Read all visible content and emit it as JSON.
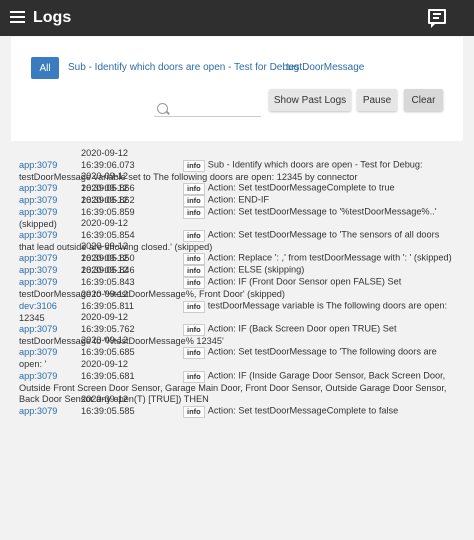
{
  "appbar": {
    "title": "Logs",
    "menu_icon": "menu-icon",
    "chat_icon": "chat-icon"
  },
  "filters": {
    "all_label": "All",
    "items": [
      "Sub - Identify which doors are open - Test for Debug",
      "testDoorMessage"
    ]
  },
  "search": {
    "placeholder": ""
  },
  "controls": {
    "show_past_logs": "Show Past Logs",
    "pause": "Pause",
    "clear": "Clear"
  },
  "logs": [
    {
      "src": "app:3079",
      "ts": "2020-09-12 16:39:06.073",
      "level": "info",
      "msg": "Sub - Identify which doors are open - Test for Debug: testDoorMessage variable set to The following doors are open:  12345 by connector"
    },
    {
      "src": "app:3079",
      "ts": "2020-09-12 16:39:05.866",
      "level": "info",
      "msg": "Action: Set testDoorMessageComplete to true"
    },
    {
      "src": "app:3079",
      "ts": "2020-09-12 16:39:05.862",
      "level": "info",
      "msg": "Action: END-IF"
    },
    {
      "src": "app:3079",
      "ts": "2020-09-12 16:39:05.859",
      "level": "info",
      "msg": "Action:     Set testDoorMessage to '%testDoorMessage%..' (skipped)"
    },
    {
      "src": "app:3079",
      "ts": "2020-09-12 16:39:05.854",
      "level": "info",
      "msg": "Action:     Set testDoorMessage to 'The sensors of all doors that lead outside are showing closed.' (skipped)"
    },
    {
      "src": "app:3079",
      "ts": "2020-09-12 16:39:05.850",
      "level": "info",
      "msg": "Action:     Replace ': ,' from testDoorMessage with ': ' (skipped)"
    },
    {
      "src": "app:3079",
      "ts": "2020-09-12 16:39:05.846",
      "level": "info",
      "msg": "Action: ELSE (skipping)"
    },
    {
      "src": "app:3079",
      "ts": "2020-09-12 16:39:05.843",
      "level": "info",
      "msg": "Action:     IF (Front Door Sensor open FALSE) Set testDoorMessage to '%testDoorMessage%, Front Door' (skipped)"
    },
    {
      "src": "dev:3106",
      "ts": "2020-09-12 16:39:05.811",
      "level": "info",
      "msg": "testDoorMessage variable is The following doors are open: 12345"
    },
    {
      "src": "app:3079",
      "ts": "2020-09-12 16:39:05.762",
      "level": "info",
      "msg": "Action:     IF (Back Screen Door open TRUE) Set testDoorMessage to '%testDoorMessage% 12345'"
    },
    {
      "src": "app:3079",
      "ts": "2020-09-12 16:39:05.685",
      "level": "info",
      "msg": "Action:     Set testDoorMessage to 'The following doors are open: '"
    },
    {
      "src": "app:3079",
      "ts": "2020-09-12 16:39:05.681",
      "level": "info",
      "msg": "Action: IF (Inside Garage Door Sensor, Back Screen Door, Outside Front Screen Door Sensor, Garage Main Door, Front Door Sensor, Outside Garage Door Sensor, Back Door Sensor any open(T) [TRUE]) THEN"
    },
    {
      "src": "app:3079",
      "ts": "2020-09-12 16:39:05.585",
      "level": "info",
      "msg": "Action: Set testDoorMessageComplete to false"
    }
  ]
}
